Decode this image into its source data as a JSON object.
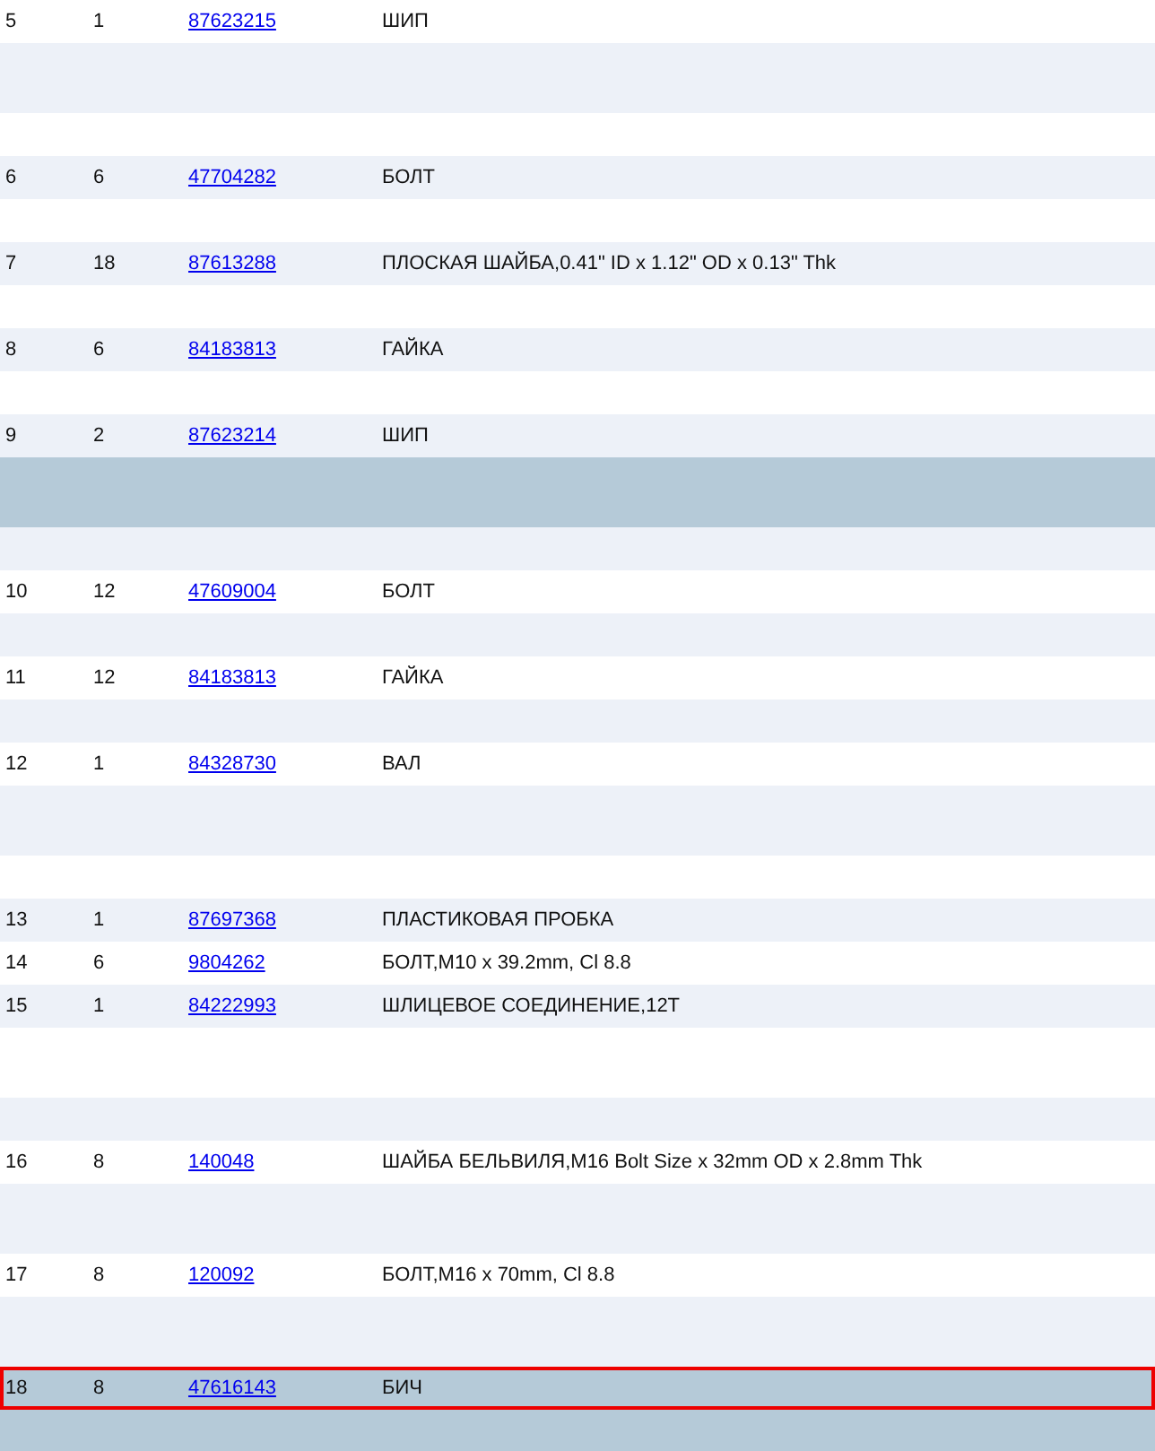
{
  "rows": [
    {
      "kind": "part",
      "selected": false,
      "focused": false,
      "item": "5",
      "qty": "1",
      "part_number": "87623215",
      "description": "ШИП"
    },
    {
      "kind": "wide-gap",
      "selected": false
    },
    {
      "kind": "gap",
      "selected": false
    },
    {
      "kind": "part",
      "selected": false,
      "focused": false,
      "item": "6",
      "qty": "6",
      "part_number": "47704282",
      "description": "БОЛТ"
    },
    {
      "kind": "gap",
      "selected": false
    },
    {
      "kind": "part",
      "selected": false,
      "focused": false,
      "item": "7",
      "qty": "18",
      "part_number": "87613288",
      "description": "ПЛОСКАЯ ШАЙБА,0.41\" ID x 1.12\" OD x 0.13\" Thk"
    },
    {
      "kind": "gap",
      "selected": false
    },
    {
      "kind": "part",
      "selected": false,
      "focused": false,
      "item": "8",
      "qty": "6",
      "part_number": "84183813",
      "description": "ГАЙКА"
    },
    {
      "kind": "gap",
      "selected": false
    },
    {
      "kind": "part",
      "selected": false,
      "focused": false,
      "item": "9",
      "qty": "2",
      "part_number": "87623214",
      "description": "ШИП"
    },
    {
      "kind": "wide-gap",
      "selected": true
    },
    {
      "kind": "gap",
      "selected": false
    },
    {
      "kind": "part",
      "selected": false,
      "focused": false,
      "item": "10",
      "qty": "12",
      "part_number": "47609004",
      "description": "БОЛТ"
    },
    {
      "kind": "gap",
      "selected": false
    },
    {
      "kind": "part",
      "selected": false,
      "focused": false,
      "item": "11",
      "qty": "12",
      "part_number": "84183813",
      "description": "ГАЙКА"
    },
    {
      "kind": "gap",
      "selected": false
    },
    {
      "kind": "part",
      "selected": false,
      "focused": false,
      "item": "12",
      "qty": "1",
      "part_number": "84328730",
      "description": "ВАЛ"
    },
    {
      "kind": "wide-gap",
      "selected": false
    },
    {
      "kind": "gap",
      "selected": false
    },
    {
      "kind": "part",
      "selected": false,
      "focused": false,
      "item": "13",
      "qty": "1",
      "part_number": "87697368",
      "description": "ПЛАСТИКОВАЯ ПРОБКА"
    },
    {
      "kind": "part",
      "selected": false,
      "focused": false,
      "item": "14",
      "qty": "6",
      "part_number": "9804262",
      "description": "БОЛТ,M10 x 39.2mm, Cl 8.8"
    },
    {
      "kind": "part",
      "selected": false,
      "focused": false,
      "item": "15",
      "qty": "1",
      "part_number": "84222993",
      "description": "ШЛИЦЕВОЕ СОЕДИНЕНИЕ,12T"
    },
    {
      "kind": "wide-gap",
      "selected": false
    },
    {
      "kind": "gap",
      "selected": false
    },
    {
      "kind": "part",
      "selected": false,
      "focused": false,
      "item": "16",
      "qty": "8",
      "part_number": "140048",
      "description": "ШАЙБА БЕЛЬВИЛЯ,M16 Bolt Size x 32mm OD x 2.8mm Thk"
    },
    {
      "kind": "wide-gap",
      "selected": false
    },
    {
      "kind": "part",
      "selected": false,
      "focused": false,
      "item": "17",
      "qty": "8",
      "part_number": "120092",
      "description": "БОЛТ,M16 x 70mm, Cl 8.8"
    },
    {
      "kind": "wide-gap",
      "selected": false
    },
    {
      "kind": "part",
      "selected": true,
      "focused": true,
      "item": "18",
      "qty": "8",
      "part_number": "47616143",
      "description": "БИЧ"
    },
    {
      "kind": "gap",
      "selected": true
    }
  ]
}
